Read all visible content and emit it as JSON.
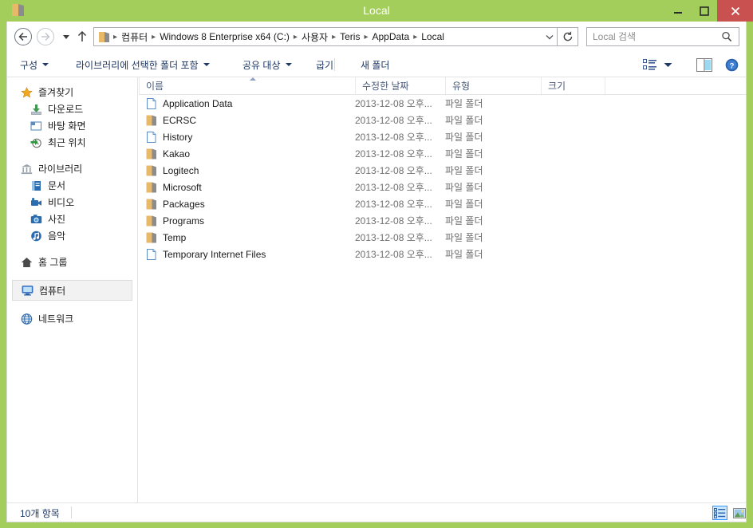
{
  "window": {
    "title": "Local",
    "icon": "folder-icon",
    "controls": {
      "minimize": "minimize-button",
      "maximize": "maximize-button",
      "close": "close-button"
    },
    "accent_color": "#A4CE5C",
    "close_color": "#C9514F"
  },
  "addressbar": {
    "back": "back-button",
    "forward": "forward-button",
    "history": "recent-locations-button",
    "up": "up-button",
    "refresh": "refresh-button",
    "dropdown": "address-dropdown",
    "breadcrumbs": [
      "컴퓨터",
      "Windows 8 Enterprise x64 (C:)",
      "사용자",
      "Teris",
      "AppData",
      "Local"
    ],
    "separator": "▸"
  },
  "search": {
    "placeholder": "Local 검색",
    "value": "",
    "icon": "search-icon"
  },
  "toolbar": {
    "organize": "구성",
    "include_in_library": "라이브러리에 선택한 폴더 포함",
    "share_with": "공유 대상",
    "burn": "굽기",
    "new_folder": "새 폴더",
    "view_options_icon": "view-options-icon",
    "preview_pane_icon": "preview-pane-icon",
    "help_icon": "help-icon"
  },
  "sidebar": {
    "groups": [
      {
        "header": {
          "label": "즐겨찾기",
          "icon": "star-icon"
        },
        "items": [
          {
            "label": "다운로드",
            "icon": "download-icon"
          },
          {
            "label": "바탕 화면",
            "icon": "desktop-icon"
          },
          {
            "label": "최근 위치",
            "icon": "recent-icon"
          }
        ]
      },
      {
        "header": {
          "label": "라이브러리",
          "icon": "library-icon"
        },
        "items": [
          {
            "label": "문서",
            "icon": "documents-icon"
          },
          {
            "label": "비디오",
            "icon": "videos-icon"
          },
          {
            "label": "사진",
            "icon": "pictures-icon"
          },
          {
            "label": "음악",
            "icon": "music-icon"
          }
        ]
      },
      {
        "header": {
          "label": "홈 그룹",
          "icon": "homegroup-icon"
        },
        "items": []
      },
      {
        "header": {
          "label": "컴퓨터",
          "icon": "computer-icon",
          "selected": true
        },
        "items": []
      },
      {
        "header": {
          "label": "네트워크",
          "icon": "network-icon"
        },
        "items": []
      }
    ]
  },
  "filelist": {
    "columns": [
      {
        "label": "이름",
        "key": "name"
      },
      {
        "label": "수정한 날짜",
        "key": "date"
      },
      {
        "label": "유형",
        "key": "type"
      },
      {
        "label": "크기",
        "key": "size"
      }
    ],
    "sort_column": "이름",
    "sort_direction": "asc",
    "rows": [
      {
        "name": "Application Data",
        "date": "2013-12-08 오후...",
        "type": "파일 폴더",
        "size": "",
        "icon": "junction-icon"
      },
      {
        "name": "ECRSC",
        "date": "2013-12-08 오후...",
        "type": "파일 폴더",
        "size": "",
        "icon": "folder-icon"
      },
      {
        "name": "History",
        "date": "2013-12-08 오후...",
        "type": "파일 폴더",
        "size": "",
        "icon": "junction-icon"
      },
      {
        "name": "Kakao",
        "date": "2013-12-08 오후...",
        "type": "파일 폴더",
        "size": "",
        "icon": "folder-icon"
      },
      {
        "name": "Logitech",
        "date": "2013-12-08 오후...",
        "type": "파일 폴더",
        "size": "",
        "icon": "folder-icon"
      },
      {
        "name": "Microsoft",
        "date": "2013-12-08 오후...",
        "type": "파일 폴더",
        "size": "",
        "icon": "folder-icon"
      },
      {
        "name": "Packages",
        "date": "2013-12-08 오후...",
        "type": "파일 폴더",
        "size": "",
        "icon": "folder-icon"
      },
      {
        "name": "Programs",
        "date": "2013-12-08 오후...",
        "type": "파일 폴더",
        "size": "",
        "icon": "folder-icon"
      },
      {
        "name": "Temp",
        "date": "2013-12-08 오후...",
        "type": "파일 폴더",
        "size": "",
        "icon": "folder-icon"
      },
      {
        "name": "Temporary Internet Files",
        "date": "2013-12-08 오후...",
        "type": "파일 폴더",
        "size": "",
        "icon": "junction-icon"
      }
    ]
  },
  "statusbar": {
    "item_count": "10개 항목",
    "details_view_icon": "details-view-icon",
    "large_icons_view_icon": "large-icons-view-icon",
    "selected_view": "details"
  }
}
